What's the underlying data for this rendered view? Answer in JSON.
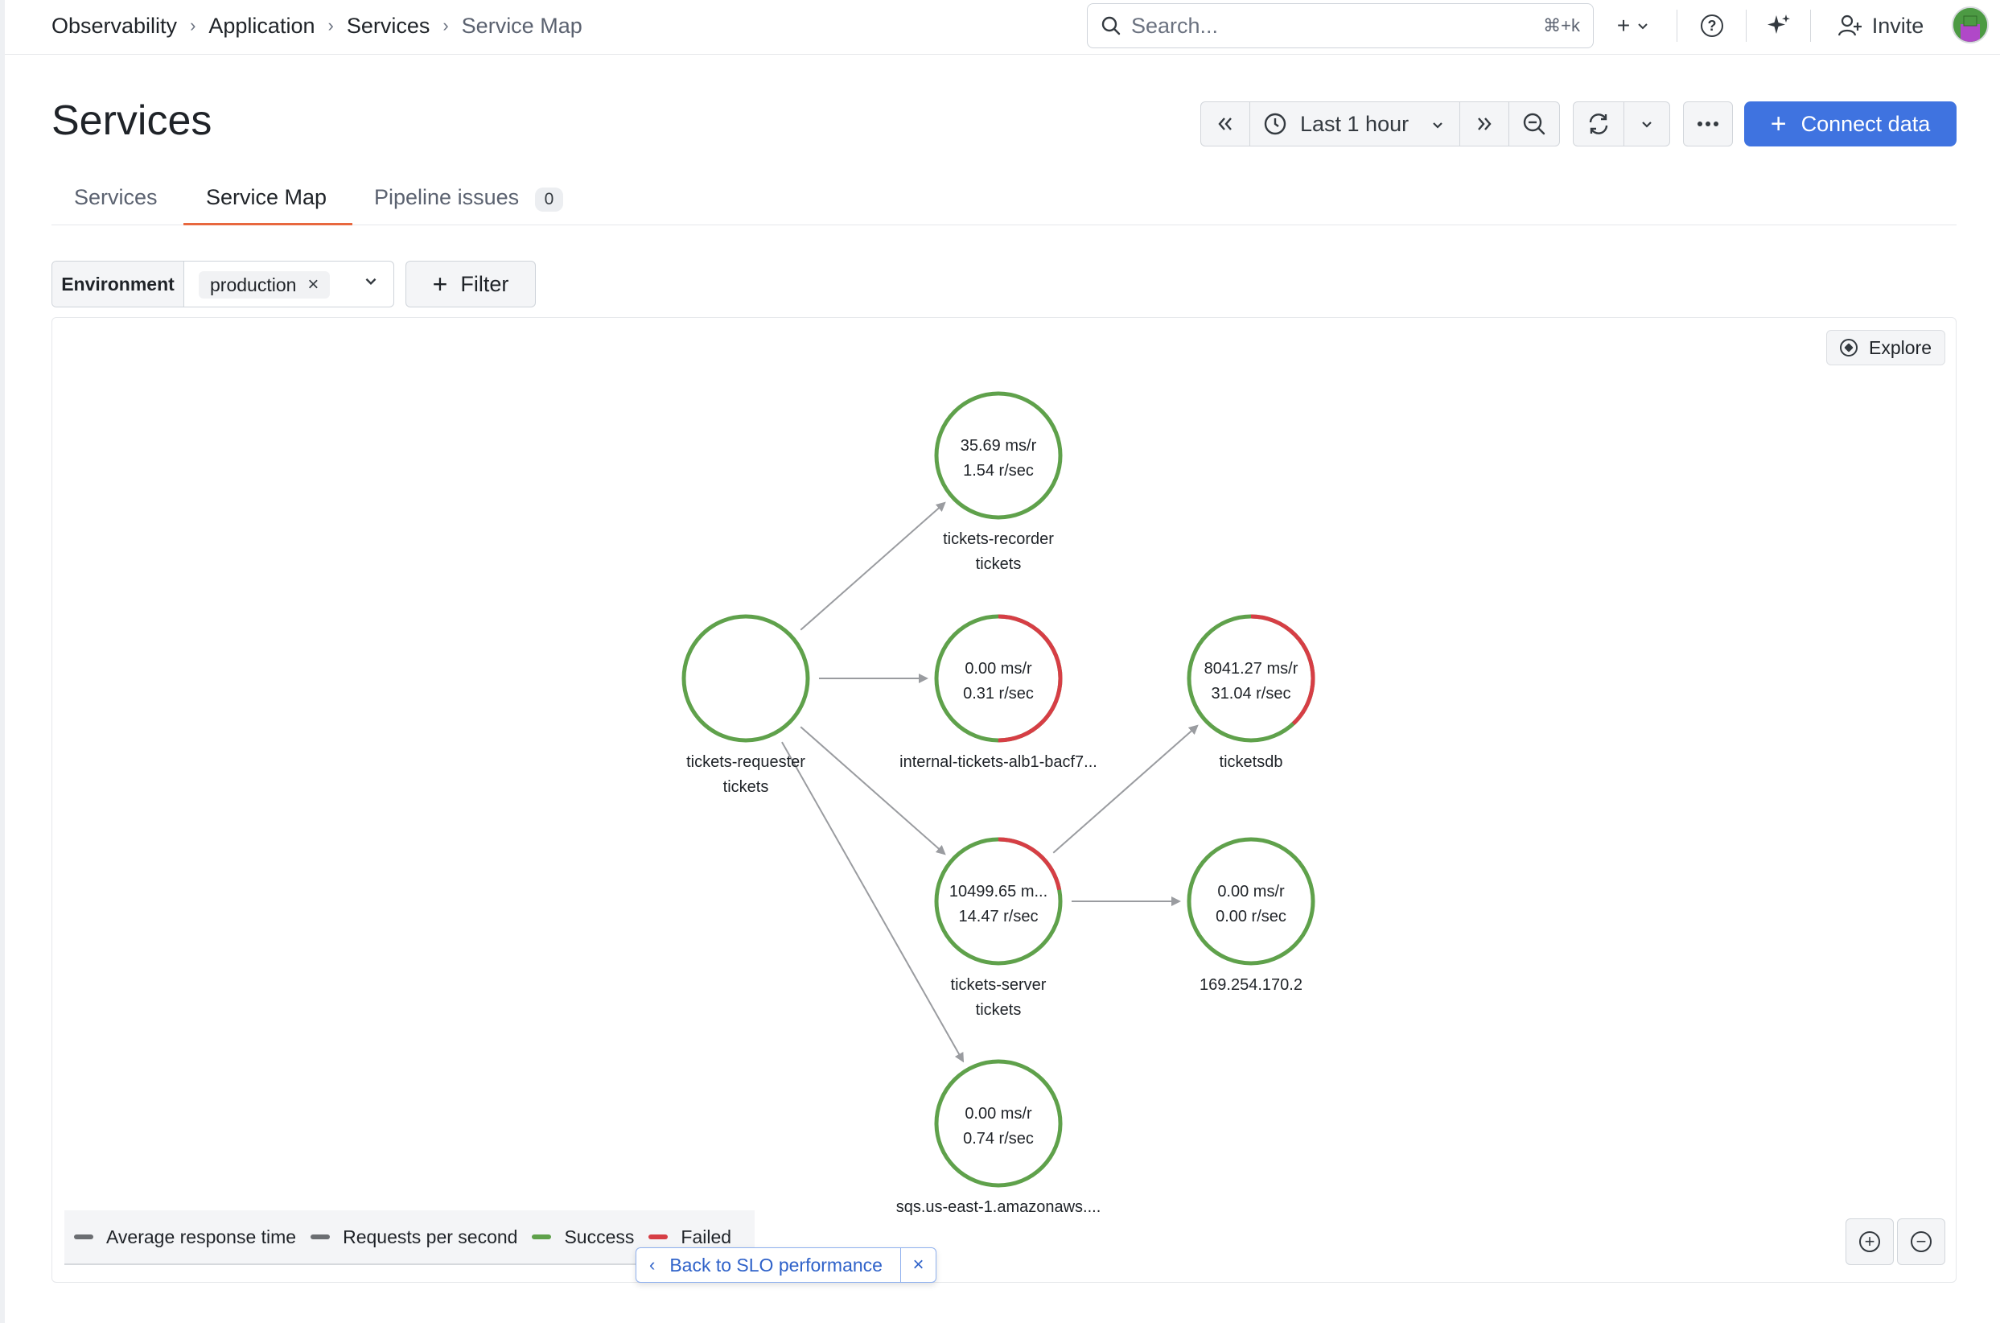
{
  "breadcrumbs": [
    {
      "label": "Observability"
    },
    {
      "label": "Application"
    },
    {
      "label": "Services"
    },
    {
      "label": "Service Map"
    }
  ],
  "header": {
    "search_placeholder": "Search...",
    "search_shortcut": "⌘+k",
    "create_glyph": "+",
    "help_glyph": "?",
    "ai_icon": "sparkle-icon",
    "invite_label": "Invite"
  },
  "page": {
    "title": "Services",
    "time_range": "Last 1 hour",
    "connect_label": "Connect data"
  },
  "tabs": [
    {
      "label": "Services",
      "active": false
    },
    {
      "label": "Service Map",
      "active": true
    },
    {
      "label": "Pipeline issues",
      "badge": "0",
      "active": false
    }
  ],
  "filters": {
    "environment_label": "Environment",
    "environment_value": "production",
    "filter_label": "Filter"
  },
  "map": {
    "explore_label": "Explore",
    "nodes": [
      {
        "id": "recorder",
        "line1": "35.69 ms/r",
        "line2": "1.54 r/sec",
        "label1": "tickets-recorder",
        "label2": "tickets",
        "failed_fraction": 0
      },
      {
        "id": "requester",
        "line1": "",
        "line2": "",
        "label1": "tickets-requester",
        "label2": "tickets",
        "failed_fraction": 0
      },
      {
        "id": "alb",
        "line1": "0.00 ms/r",
        "line2": "0.31 r/sec",
        "label1": "internal-tickets-alb1-bacf7...",
        "label2": "",
        "failed_fraction": 0.5
      },
      {
        "id": "ticketsdb",
        "line1": "8041.27 ms/r",
        "line2": "31.04 r/sec",
        "label1": "ticketsdb",
        "label2": "",
        "failed_fraction": 0.38
      },
      {
        "id": "server",
        "line1": "10499.65 m...",
        "line2": "14.47 r/sec",
        "label1": "tickets-server",
        "label2": "tickets",
        "failed_fraction": 0.22
      },
      {
        "id": "ip",
        "line1": "0.00 ms/r",
        "line2": "0.00 r/sec",
        "label1": "169.254.170.2",
        "label2": "",
        "failed_fraction": 0
      },
      {
        "id": "sqs",
        "line1": "0.00 ms/r",
        "line2": "0.74 r/sec",
        "label1": "sqs.us-east-1.amazonaws....",
        "label2": "",
        "failed_fraction": 0
      }
    ],
    "edges": [
      {
        "from": "requester",
        "to": "recorder"
      },
      {
        "from": "requester",
        "to": "alb"
      },
      {
        "from": "requester",
        "to": "server"
      },
      {
        "from": "requester",
        "to": "sqs"
      },
      {
        "from": "server",
        "to": "ticketsdb"
      },
      {
        "from": "server",
        "to": "ip"
      }
    ],
    "colors": {
      "success": "#5fa14b",
      "failed": "#d63e45",
      "edge": "#9a9ca0"
    }
  },
  "legend": [
    {
      "label": "Average response time",
      "color": "#6b6e72"
    },
    {
      "label": "Requests per second",
      "color": "#6b6e72"
    },
    {
      "label": "Success",
      "color": "#5fa14b"
    },
    {
      "label": "Failed",
      "color": "#d63e45"
    }
  ],
  "back_to_slo": {
    "label": "Back to SLO performance",
    "chevron": "‹",
    "close": "×"
  }
}
